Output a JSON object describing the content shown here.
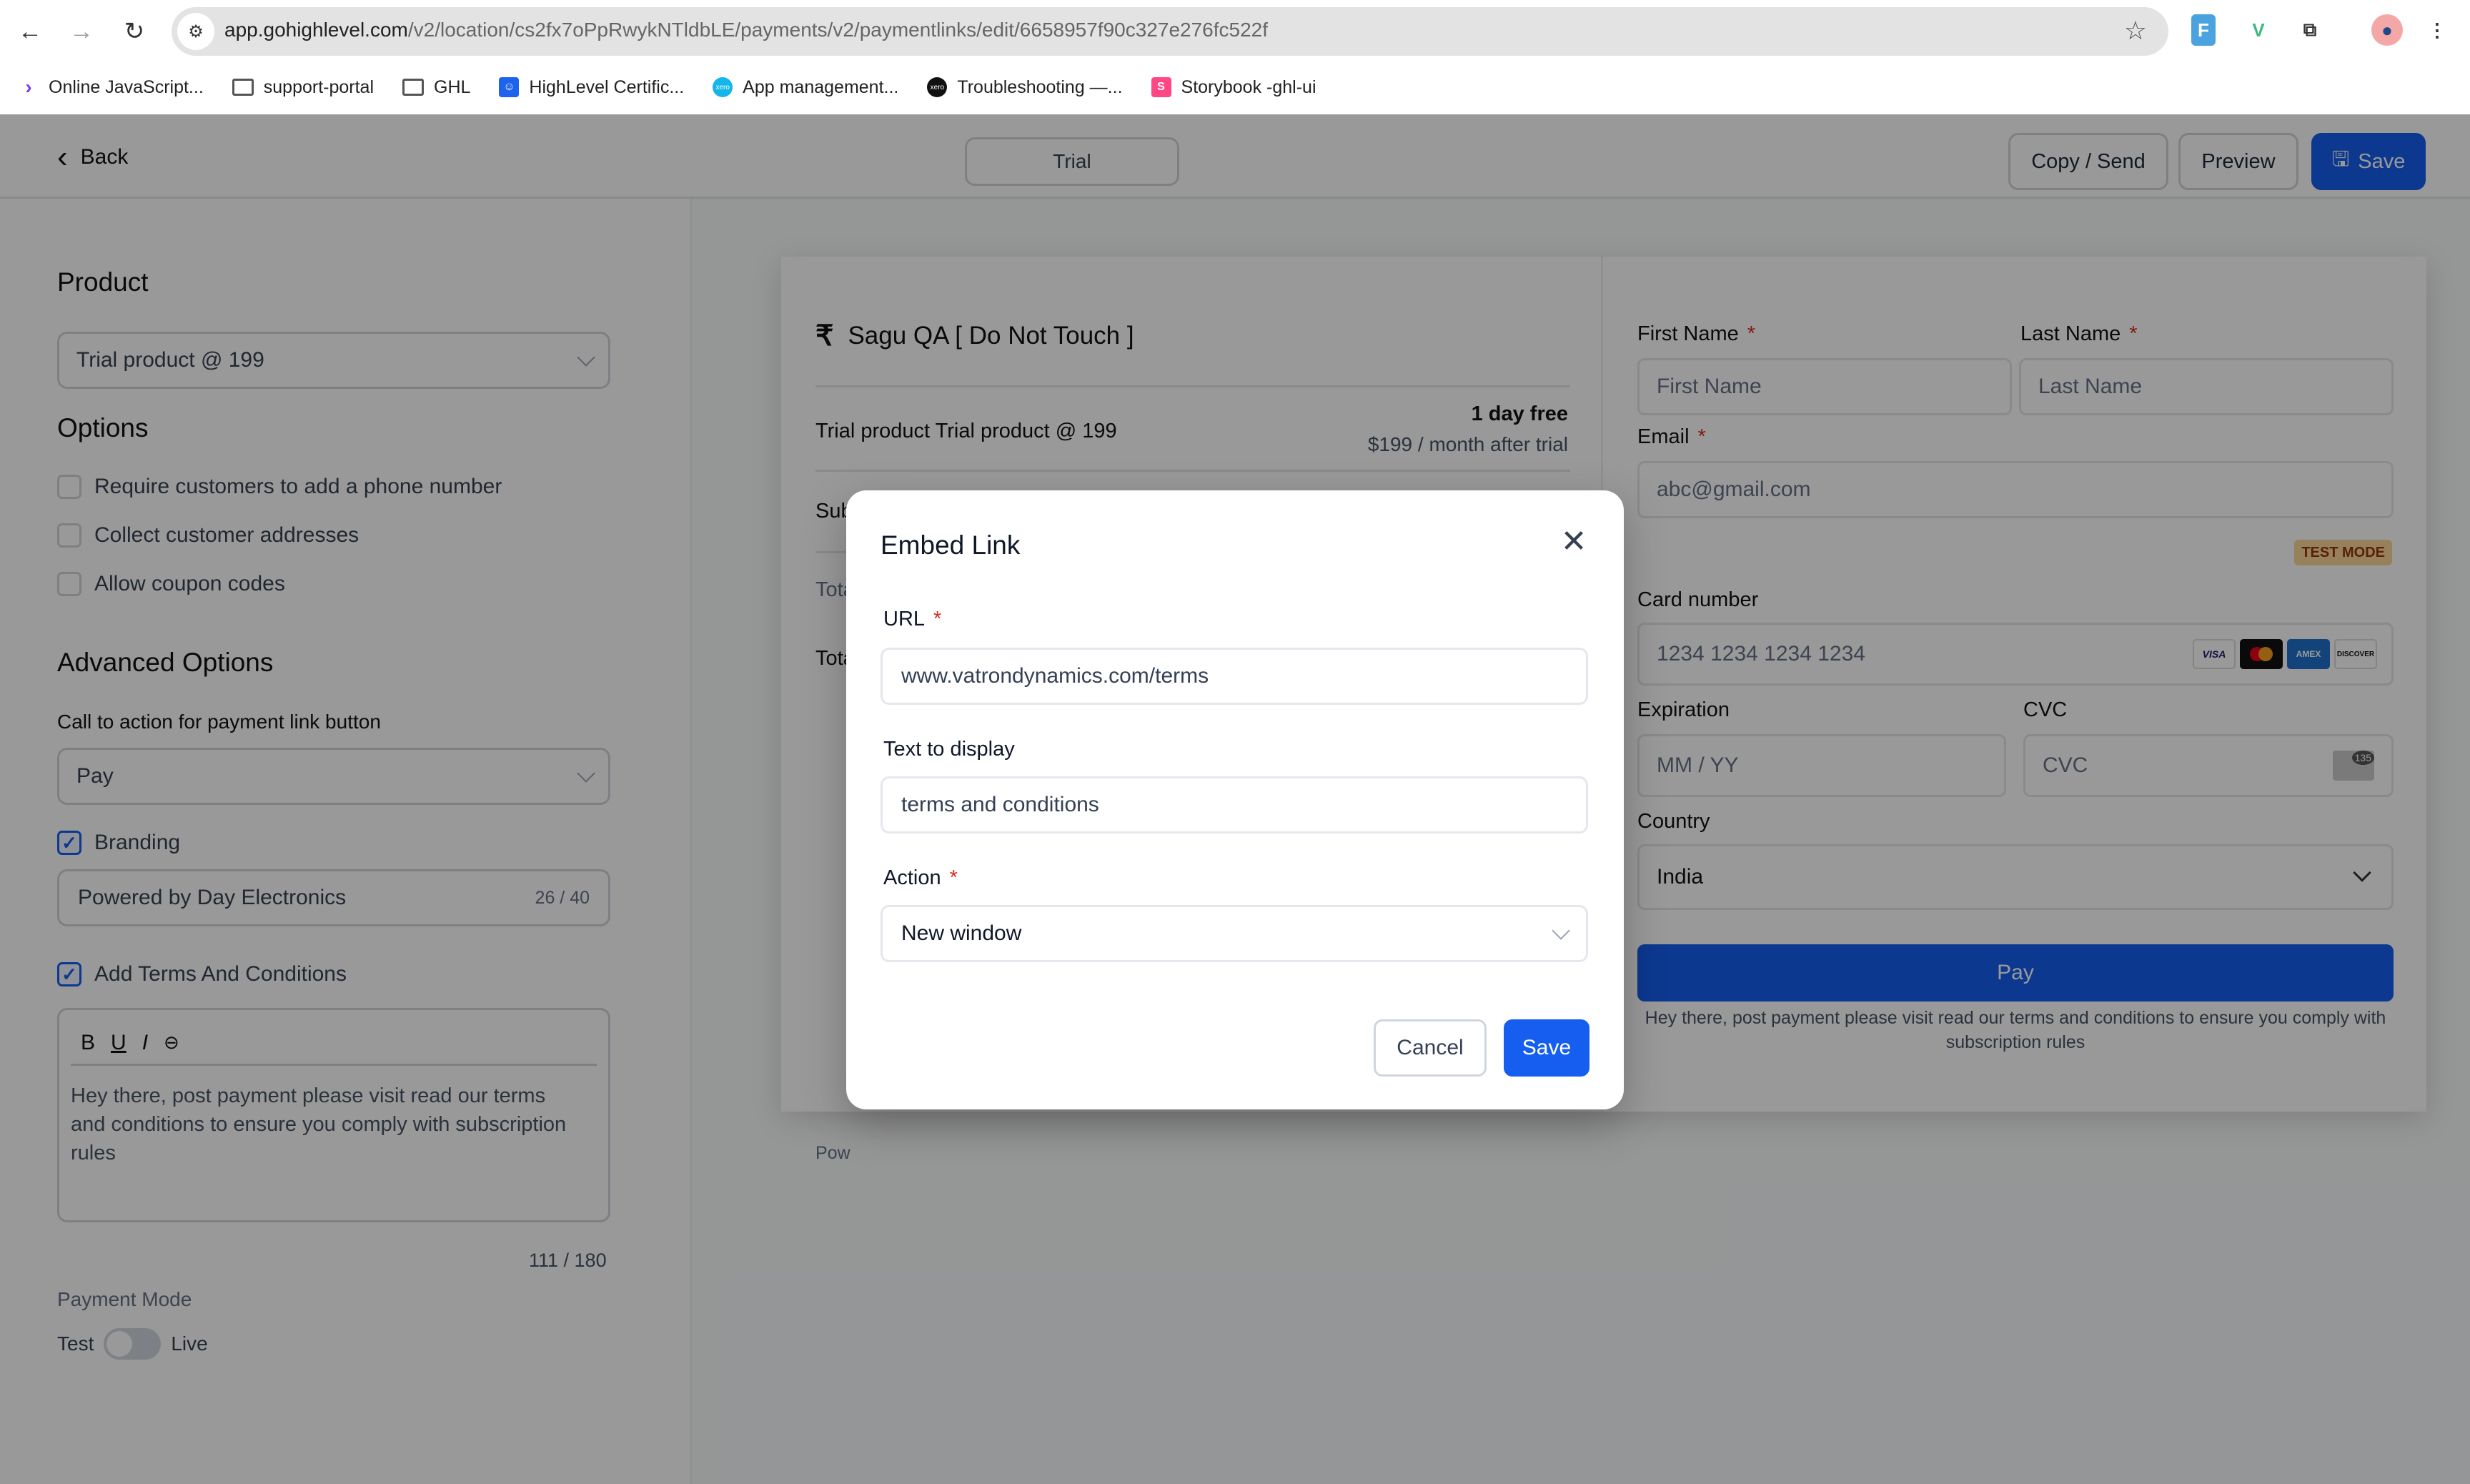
{
  "browser": {
    "url_host": "app.gohighlevel.com",
    "url_path": "/v2/location/cs2fx7oPpRwykNTldbLE/payments/v2/paymentlinks/edit/6658957f90c327e276fc522f",
    "bookmarks": [
      {
        "label": "Online JavaScript...",
        "icon": "playcode-icon"
      },
      {
        "label": "support-portal",
        "icon": "folder-icon"
      },
      {
        "label": "GHL",
        "icon": "folder-icon"
      },
      {
        "label": "HighLevel Certific...",
        "icon": "highlevel-icon"
      },
      {
        "label": "App management...",
        "icon": "xero-icon"
      },
      {
        "label": "Troubleshooting —...",
        "icon": "xero-dark-icon"
      },
      {
        "label": "Storybook -ghl-ui",
        "icon": "storybook-icon"
      }
    ]
  },
  "header": {
    "back_label": "Back",
    "tab_label": "Trial",
    "copy_send_label": "Copy / Send",
    "preview_label": "Preview",
    "save_label": "Save"
  },
  "left_panel": {
    "product_heading": "Product",
    "product_selected": "Trial product @ 199",
    "options_heading": "Options",
    "options": [
      {
        "label": "Require customers to add a phone number",
        "checked": false
      },
      {
        "label": "Collect customer addresses",
        "checked": false
      },
      {
        "label": "Allow coupon codes",
        "checked": false
      }
    ],
    "advanced_heading": "Advanced Options",
    "cta_label": "Call to action for payment link button",
    "cta_selected": "Pay",
    "branding_label": "Branding",
    "branding_checked": true,
    "branding_value": "Powered by Day Electronics",
    "branding_count": "26 / 40",
    "terms_label": "Add Terms And Conditions",
    "terms_checked": true,
    "editor_tools": [
      "B",
      "U",
      "I",
      "link"
    ],
    "terms_text": "Hey there, post payment please visit read our terms and conditions to ensure you comply with subscription rules",
    "terms_count": "111 / 180",
    "payment_mode_label": "Payment Mode",
    "mode_test": "Test",
    "mode_live": "Live",
    "mode_live_on": false
  },
  "preview": {
    "currency_symbol": "₹",
    "business_name": "Sagu QA [ Do Not Touch ]",
    "line_item": "Trial product Trial product @ 199",
    "trial_label": "1 day free",
    "after_trial": "$199 / month after trial",
    "subtotal_fragment": "Sub",
    "total_fragment_1": "Tota",
    "total_fragment_2": "Tota",
    "powered_fragment": "Pow",
    "first_name_label": "First Name",
    "first_name_placeholder": "First Name",
    "last_name_label": "Last Name",
    "last_name_placeholder": "Last Name",
    "email_label": "Email",
    "email_placeholder": "abc@gmail.com",
    "test_mode_badge": "TEST MODE",
    "card_label": "Card number",
    "card_placeholder": "1234 1234 1234 1234",
    "card_brands": [
      "VISA",
      "Mastercard",
      "AMEX",
      "DISCOVER"
    ],
    "expiration_label": "Expiration",
    "expiration_placeholder": "MM / YY",
    "cvc_label": "CVC",
    "cvc_placeholder": "CVC",
    "cvc_icon_text": "135",
    "country_label": "Country",
    "country_value": "India",
    "pay_label": "Pay",
    "terms_text": "Hey there, post payment please visit read our terms and conditions to ensure you comply with subscription rules"
  },
  "modal": {
    "title": "Embed Link",
    "url_label": "URL",
    "url_value": "www.vatrondynamics.com/terms",
    "text_label": "Text to display",
    "text_value": "terms and conditions",
    "action_label": "Action",
    "action_value": "New window",
    "cancel_label": "Cancel",
    "save_label": "Save",
    "required_mark": "*"
  },
  "colors": {
    "primary": "#155eef",
    "required": "#d92d20",
    "test_badge_bg": "#fcd79b",
    "test_badge_text": "#93370d"
  }
}
